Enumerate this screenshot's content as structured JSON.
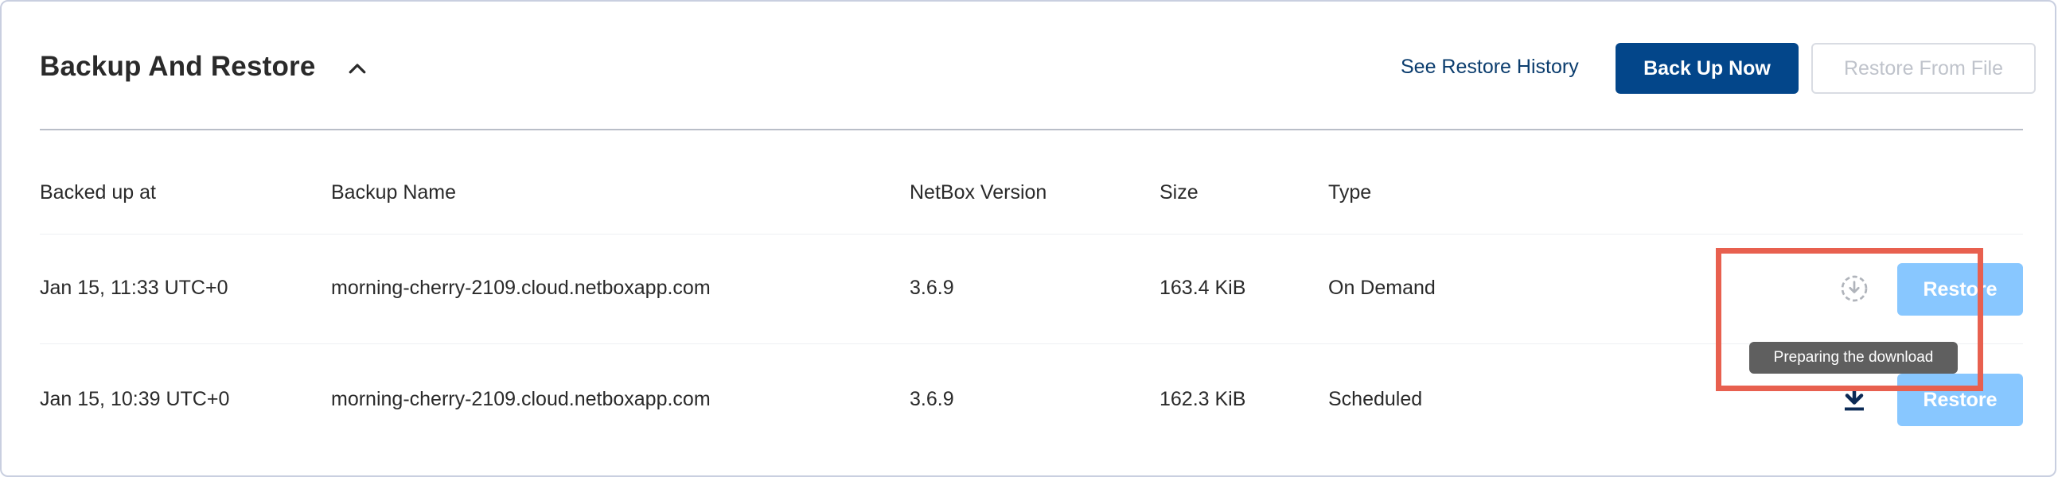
{
  "header": {
    "title": "Backup And Restore",
    "history_link": "See Restore History",
    "backup_now": "Back Up Now",
    "restore_from_file": "Restore From File"
  },
  "table": {
    "columns": [
      "Backed up at",
      "Backup Name",
      "NetBox Version",
      "Size",
      "Type"
    ],
    "rows": [
      {
        "backed_up_at": "Jan 15, 11:33 UTC+0",
        "name": "morning-cherry-2109.cloud.netboxapp.com",
        "version": "3.6.9",
        "size": "163.4 KiB",
        "type": "On Demand",
        "restore_label": "Restore",
        "download_state": "preparing",
        "tooltip": "Preparing the download"
      },
      {
        "backed_up_at": "Jan 15, 10:39 UTC+0",
        "name": "morning-cherry-2109.cloud.netboxapp.com",
        "version": "3.6.9",
        "size": "162.3 KiB",
        "type": "Scheduled",
        "restore_label": "Restore",
        "download_state": "ready"
      }
    ]
  },
  "colors": {
    "primary": "#03468a",
    "restore_button": "#88c7ff",
    "highlight": "#e8604f"
  }
}
